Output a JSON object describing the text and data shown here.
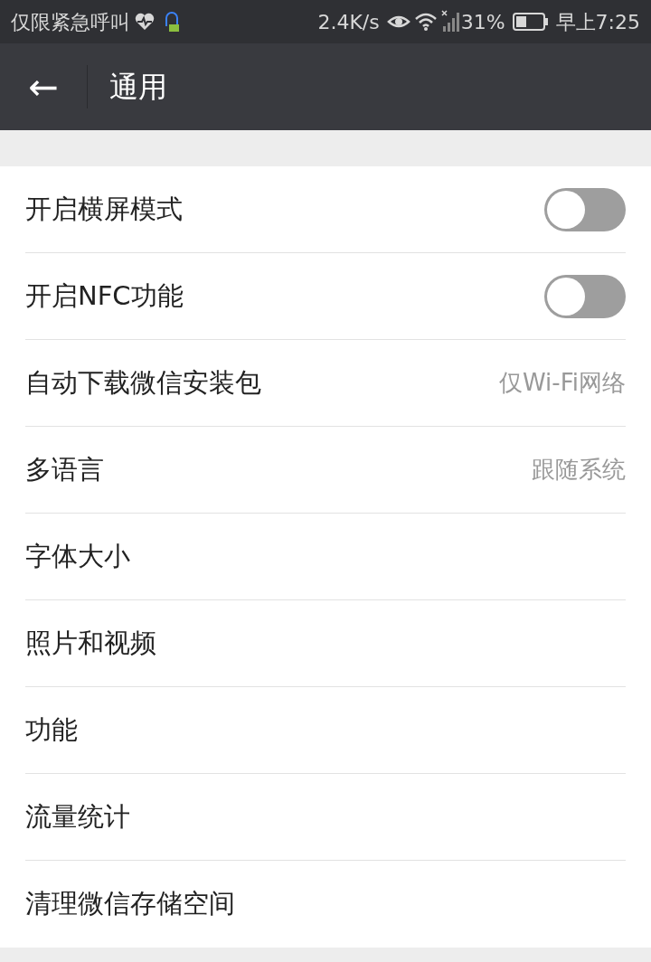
{
  "status_bar": {
    "carrier": "仅限紧急呼叫",
    "speed": "2.4K/s",
    "battery": "31%",
    "time": "早上7:25"
  },
  "header": {
    "back": "←",
    "title": "通用"
  },
  "rows": [
    {
      "kind": "toggle",
      "label": "开启横屏模式",
      "on": false
    },
    {
      "kind": "toggle",
      "label": "开启NFC功能",
      "on": false
    },
    {
      "kind": "value",
      "label": "自动下载微信安装包",
      "value": "仅Wi-Fi网络"
    },
    {
      "kind": "value",
      "label": "多语言",
      "value": "跟随系统"
    },
    {
      "kind": "link",
      "label": "字体大小"
    },
    {
      "kind": "link",
      "label": "照片和视频"
    },
    {
      "kind": "link",
      "label": "功能"
    },
    {
      "kind": "link",
      "label": "流量统计"
    },
    {
      "kind": "link",
      "label": "清理微信存储空间"
    }
  ]
}
